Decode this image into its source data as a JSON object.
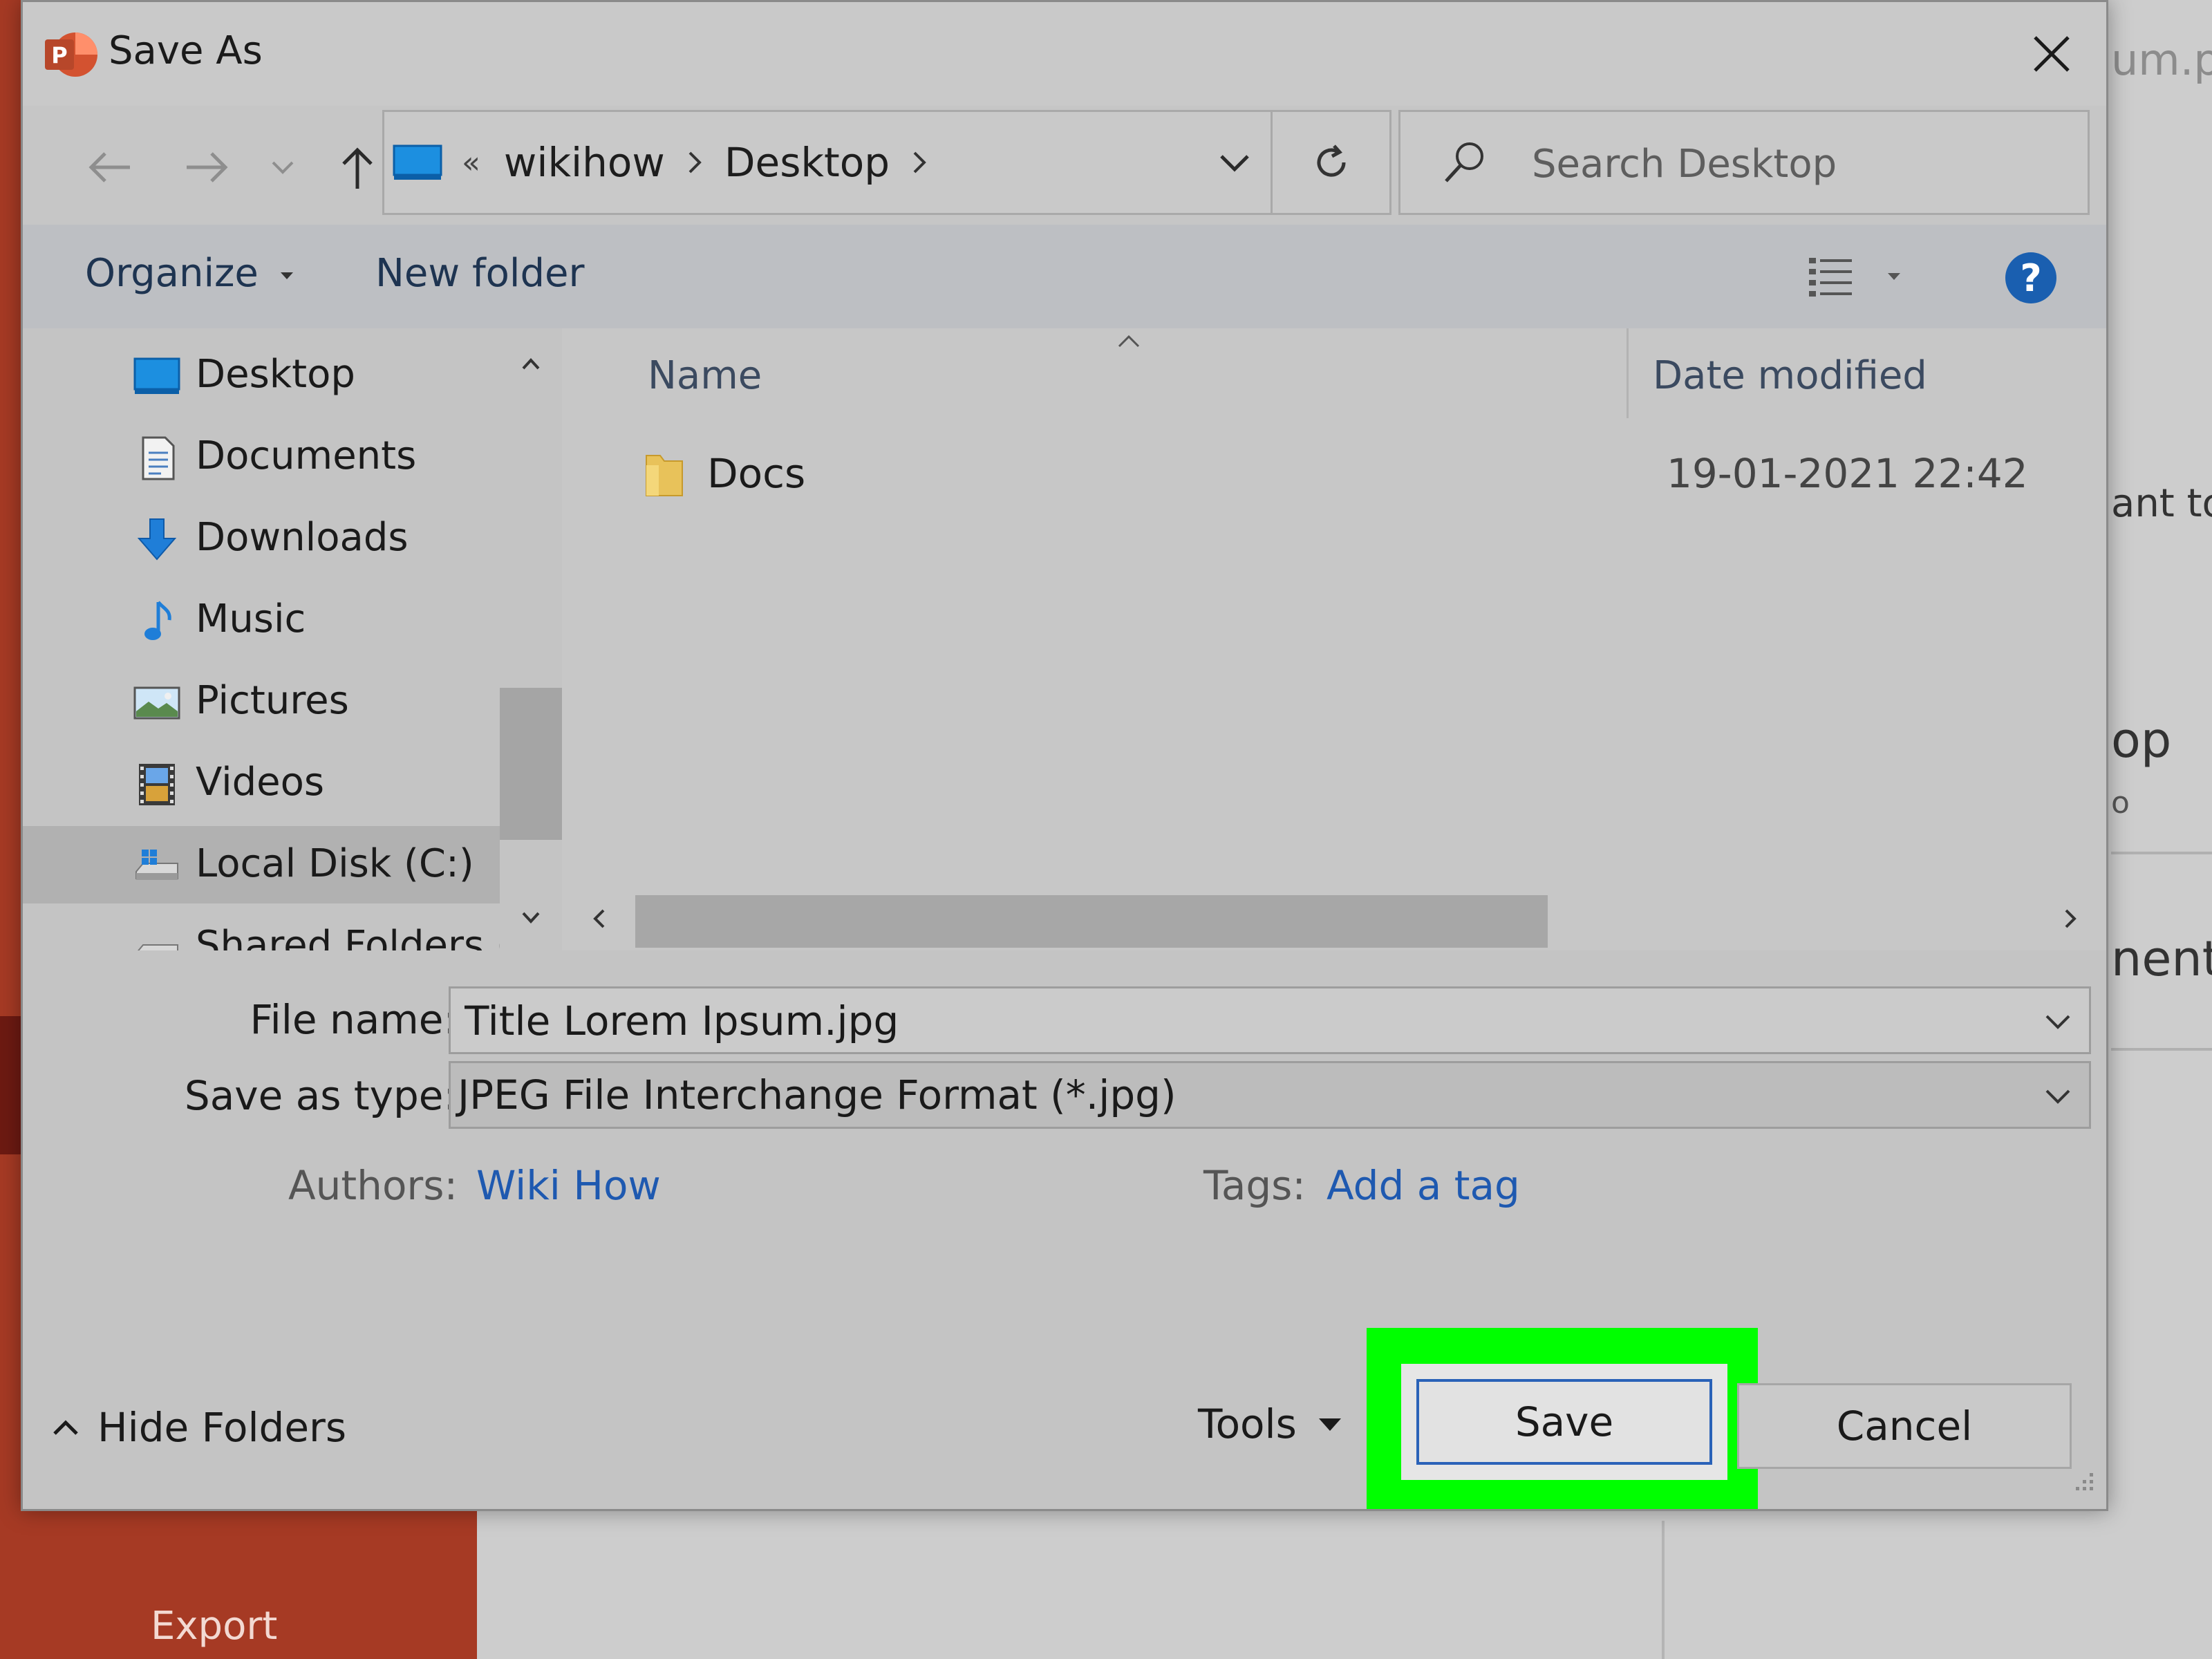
{
  "background": {
    "export_label": "Export",
    "peek_texts": [
      "um.pp",
      "ant to",
      "op",
      "o",
      "nents"
    ]
  },
  "dialog": {
    "title": "Save As",
    "close_label": "×"
  },
  "address": {
    "overflow": "«",
    "crumbs": [
      "wikihow",
      "Desktop"
    ]
  },
  "search": {
    "placeholder": "Search Desktop"
  },
  "toolbar": {
    "organize": "Organize",
    "new_folder": "New folder",
    "help": "?"
  },
  "nav_pane": {
    "items": [
      {
        "label": "Desktop",
        "icon": "desktop-icon"
      },
      {
        "label": "Documents",
        "icon": "documents-icon"
      },
      {
        "label": "Downloads",
        "icon": "downloads-icon"
      },
      {
        "label": "Music",
        "icon": "music-icon"
      },
      {
        "label": "Pictures",
        "icon": "pictures-icon"
      },
      {
        "label": "Videos",
        "icon": "videos-icon"
      },
      {
        "label": "Local Disk (C:)",
        "icon": "local-disk-icon",
        "selected": true
      },
      {
        "label": "Shared Folders (\\",
        "icon": "shared-folder-icon"
      }
    ]
  },
  "file_list": {
    "columns": [
      "Name",
      "Date modified"
    ],
    "rows": [
      {
        "name": "Docs",
        "date": "19-01-2021 22:42",
        "icon": "folder-icon"
      }
    ]
  },
  "form": {
    "file_name_label": "File name:",
    "file_name_value": "Title Lorem Ipsum.jpg",
    "save_type_label": "Save as type:",
    "save_type_value": "JPEG File Interchange Format (*.jpg)",
    "authors_label": "Authors:",
    "authors_value": "Wiki How",
    "tags_label": "Tags:",
    "tags_value": "Add a tag"
  },
  "footer": {
    "hide_folders": "Hide Folders",
    "tools": "Tools",
    "save": "Save",
    "cancel": "Cancel"
  },
  "colors": {
    "accent": "#1a5fb0",
    "highlight": "#00ff00",
    "link": "#1e59b0",
    "app_brand": "#a63a24"
  }
}
